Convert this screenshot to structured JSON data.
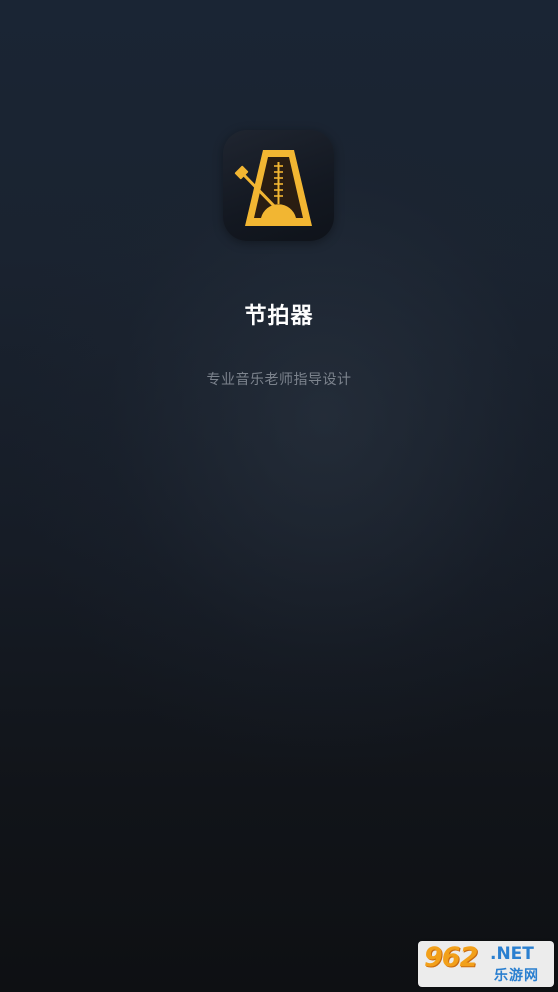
{
  "app": {
    "name": "节拍器",
    "tagline": "专业音乐老师指导设计"
  },
  "icon": {
    "name": "metronome-icon",
    "accent_color": "#f2b632",
    "background_color": "#141922"
  },
  "watermark": {
    "logo_text": "962",
    "domain_suffix": ".NET",
    "site_name": "乐游网"
  },
  "colors": {
    "background_top": "#1a2534",
    "background_bottom": "#0e1013",
    "title_text": "#ffffff",
    "tagline_text": "#7c838d"
  }
}
